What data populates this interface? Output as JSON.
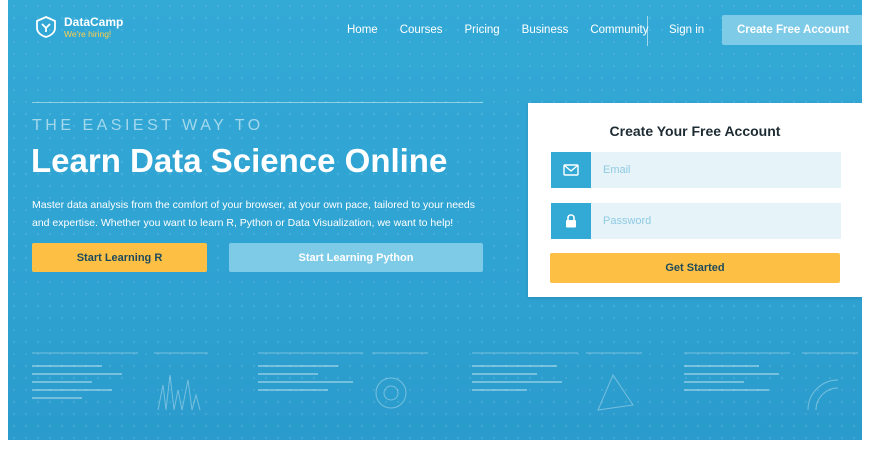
{
  "brand": {
    "name": "DataCamp",
    "tagline": "We're hiring!",
    "colors": {
      "primary": "#33a9d6",
      "accent": "#fdc045",
      "light": "#7ecbe8"
    }
  },
  "nav": {
    "links": [
      "Home",
      "Courses",
      "Pricing",
      "Business",
      "Community"
    ],
    "sign_in": "Sign in",
    "cta": "Create Free Account"
  },
  "hero": {
    "eyebrow": "THE EASIEST WAY TO",
    "headline": "Learn Data Science Online",
    "description": "Master data analysis from the comfort of your browser, at your own pace, tailored to your needs and expertise. Whether you want to learn R, Python or Data Visualization, we want to help!",
    "buttons": {
      "r": "Start Learning R",
      "python": "Start Learning Python"
    }
  },
  "signup": {
    "title": "Create Your Free Account",
    "email_placeholder": "Email",
    "password_placeholder": "Password",
    "submit": "Get Started",
    "icons": {
      "email": "envelope-icon",
      "password": "lock-icon"
    }
  }
}
